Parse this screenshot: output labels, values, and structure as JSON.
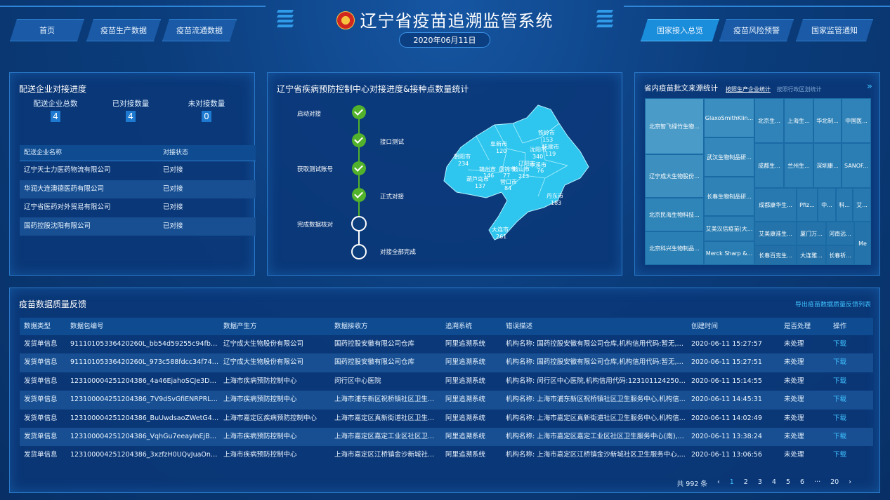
{
  "header": {
    "title": "辽宁省疫苗追溯监管系统",
    "date": "2020年06月11日",
    "nav_left": [
      "首页",
      "疫苗生产数据",
      "疫苗流通数据"
    ],
    "nav_right": [
      "国家接入总览",
      "疫苗风险预警",
      "国家监管通知"
    ],
    "active_tab": "国家接入总览"
  },
  "delivery": {
    "title": "配送企业对接进度",
    "stats": [
      {
        "label": "配送企业总数",
        "value": "4"
      },
      {
        "label": "已对接数量",
        "value": "4"
      },
      {
        "label": "未对接数量",
        "value": "0"
      }
    ],
    "headers": [
      "配送企业名称",
      "对接状态"
    ],
    "rows": [
      [
        "辽宁天士力医药物流有限公司",
        "已对接"
      ],
      [
        "华润大连澳德医药有限公司",
        "已对接"
      ],
      [
        "辽宁省医药对外贸易有限公司",
        "已对接"
      ],
      [
        "国药控股沈阳有限公司",
        "已对接"
      ]
    ]
  },
  "cdc": {
    "title": "辽宁省疾病预防控制中心对接进度&接种点数量统计",
    "steps": [
      {
        "label": "启动对接",
        "done": true
      },
      {
        "label": "接口测试",
        "done": true
      },
      {
        "label": "获取测试账号",
        "done": true
      },
      {
        "label": "正式对接",
        "done": true
      },
      {
        "label": "完成数据核对",
        "done": false
      },
      {
        "label": "对接全部完成",
        "done": false
      }
    ],
    "map_labels": [
      {
        "name": "铁岭市",
        "value": "153"
      },
      {
        "name": "阜新市",
        "value": "120"
      },
      {
        "name": "沈阳市",
        "value": "340"
      },
      {
        "name": "抚顺市",
        "value": "119"
      },
      {
        "name": "朝阳市",
        "value": "234"
      },
      {
        "name": "锦州市",
        "value": "146"
      },
      {
        "name": "盘锦市",
        "value": "77"
      },
      {
        "name": "鞍山市",
        "value": "213"
      },
      {
        "name": "辽阳市",
        "value": ""
      },
      {
        "name": "本溪市",
        "value": "76"
      },
      {
        "name": "葫芦岛市",
        "value": "137"
      },
      {
        "name": "营口市",
        "value": "84"
      },
      {
        "name": "丹东市",
        "value": "183"
      },
      {
        "name": "大连市",
        "value": "261"
      }
    ]
  },
  "batch": {
    "title": "省内疫苗批文来源统计",
    "tab1": "按照生产企业统计",
    "tab2": "按照行政区划统计",
    "more": "»",
    "cells": [
      "北京智飞绿竹生物...",
      "辽宁成大生物股份...",
      "北京民海生物科技...",
      "北京科兴生物制品...",
      "GlaxoSmithKlin...",
      "武汉生物制品研...",
      "长春生物制品研...",
      "艾美汉信疫苗(大...",
      "Merck Sharp &...",
      "北京生...",
      "上海生...",
      "华北制...",
      "中国医...",
      "成都生...",
      "兰州生...",
      "深圳康...",
      "SANOF...",
      "成都康华生...",
      "Pfiz...",
      "中...",
      "科...",
      "艾...",
      "艾美康淮生...",
      "厦门万...",
      "河南远...",
      "长春百克生...",
      "大连雅...",
      "长春祈...",
      "Me"
    ]
  },
  "feedback": {
    "title": "疫苗数据质量反馈",
    "export": "导出疫苗数据质量反馈列表",
    "headers": [
      "数据类型",
      "数据包编号",
      "数据产生方",
      "数据接收方",
      "追溯系统",
      "错误描述",
      "创建时间",
      "是否处理",
      "操作"
    ],
    "rows": [
      [
        "发货单信息",
        "91110105336420260L_bb54d59255c94fbaa5...",
        "辽宁成大生物股份有限公司",
        "国药控股安徽有限公司仓库",
        "阿里追溯系统",
        "机构名称: 国药控股安徽有限公司仓库,机构信用代码:暂无,收...",
        "2020-06-11 15:27:57",
        "未处理",
        "下载"
      ],
      [
        "发货单信息",
        "91110105336420260L_973c588fdcc34f74ba...",
        "辽宁成大生物股份有限公司",
        "国药控股安徽有限公司仓库",
        "阿里追溯系统",
        "机构名称: 国药控股安徽有限公司仓库,机构信用代码:暂无,收...",
        "2020-06-11 15:27:51",
        "未处理",
        "下载"
      ],
      [
        "发货单信息",
        "123100004251204386_4a46EjahoSCJe3DCYL...",
        "上海市疾病预防控制中心",
        "闵行区中心医院",
        "阿里追溯系统",
        "机构名称: 闵行区中心医院,机构信用代码:12310112425047...",
        "2020-06-11 15:14:55",
        "未处理",
        "下载"
      ],
      [
        "发货单信息",
        "123100004251204386_7V9dSvGfiENRPRLf3f...",
        "上海市疾病预防控制中心",
        "上海市浦东新区祝桥镇社区卫生...",
        "阿里追溯系统",
        "机构名称: 上海市浦东新区祝桥镇社区卫生服务中心,机构信...",
        "2020-06-11 14:45:31",
        "未处理",
        "下载"
      ],
      [
        "发货单信息",
        "123100004251204386_BuUwdsaoZWetG4ej...",
        "上海市嘉定区疾病预防控制中心",
        "上海市嘉定区真新街道社区卫生...",
        "阿里追溯系统",
        "机构名称: 上海市嘉定区真新街道社区卫生服务中心,机构信...",
        "2020-06-11 14:02:49",
        "未处理",
        "下载"
      ],
      [
        "发货单信息",
        "123100004251204386_VqhGu7eeayInEjBKqF...",
        "上海市疾病预防控制中心",
        "上海市嘉定区嘉定工业区社区卫...",
        "阿里追溯系统",
        "机构名称: 上海市嘉定区嘉定工业区社区卫生服务中心(南),...",
        "2020-06-11 13:38:24",
        "未处理",
        "下载"
      ],
      [
        "发货单信息",
        "123100004251204386_3xzfzH0UQvJuaOnHS...",
        "上海市疾病预防控制中心",
        "上海市嘉定区江桥镇金沙新城社...",
        "阿里追溯系统",
        "机构名称: 上海市嘉定区江桥镇金沙新城社区卫生服务中心,...",
        "2020-06-11 13:06:56",
        "未处理",
        "下载"
      ]
    ],
    "pager": {
      "total": "共 992 条",
      "prev": "‹",
      "pages": [
        "1",
        "2",
        "3",
        "4",
        "5",
        "6",
        "···",
        "20"
      ],
      "next": "›",
      "current": "1"
    }
  },
  "colors": {
    "accent": "#3fc0ff",
    "done": "#52b22b",
    "map": "#2ec6ee"
  }
}
